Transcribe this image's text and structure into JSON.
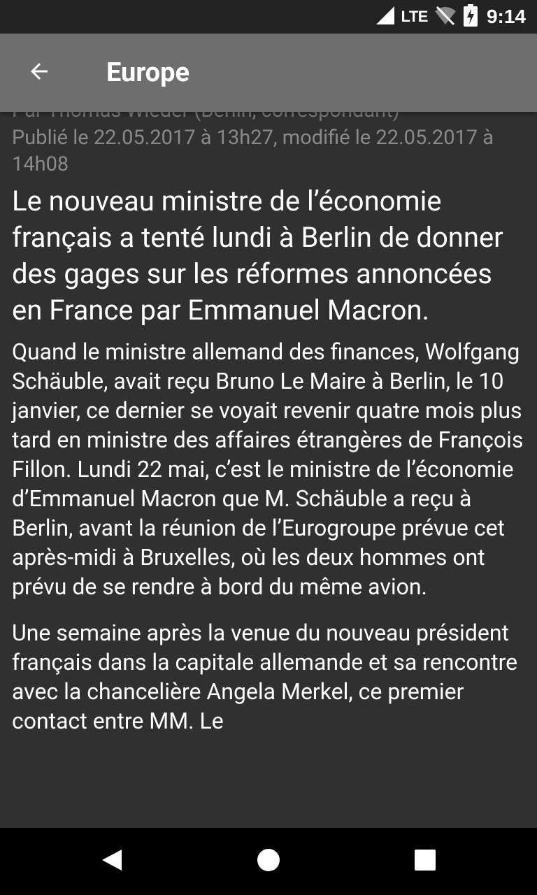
{
  "status_bar": {
    "network": "LTE",
    "time": "9:14",
    "icons": [
      "cell-signal-icon",
      "wifi-off-icon",
      "battery-charging-icon"
    ]
  },
  "toolbar": {
    "back_icon": "arrow-back-icon",
    "title": "Europe"
  },
  "article": {
    "author": "Par Thomas Wieder (Berlin, correspondant)",
    "published": "Publié le 22.05.2017 à 13h27, modifié le 22.05.2017 à 14h08",
    "lead": "Le nouveau ministre de l’économie français a tenté lundi à Berlin de donner des gages sur les réformes annoncées en France par Emmanuel Macron.",
    "paragraphs": [
      "Quand le ministre allemand des finances, Wolfgang Schäuble, avait reçu Bruno Le Maire à Berlin, le 10 janvier, ce dernier se voyait revenir quatre mois plus tard en ministre des affaires étrangères de François Fillon. Lundi 22 mai, c’est le ministre de l’économie d’Emmanuel Macron que M. Schäuble a reçu à Berlin, avant la réunion de l’Eurogroupe prévue cet après-midi à Bruxelles, où les deux hommes ont prévu de se rendre à bord du même avion.",
      "Une semaine après la venue du nouveau président français dans la capitale allemande et sa rencontre avec la chancelière Angela Merkel, ce premier contact entre MM. Le"
    ]
  },
  "nav_bar": {
    "icons": [
      "back-triangle-icon",
      "home-circle-icon",
      "recents-square-icon"
    ]
  },
  "colors": {
    "background": "#303030",
    "toolbar": "#6e6e6e",
    "status_bar": "#232323",
    "nav_bar": "#000000",
    "meta_text": "#8a8a8a",
    "body_text": "#ffffff"
  }
}
